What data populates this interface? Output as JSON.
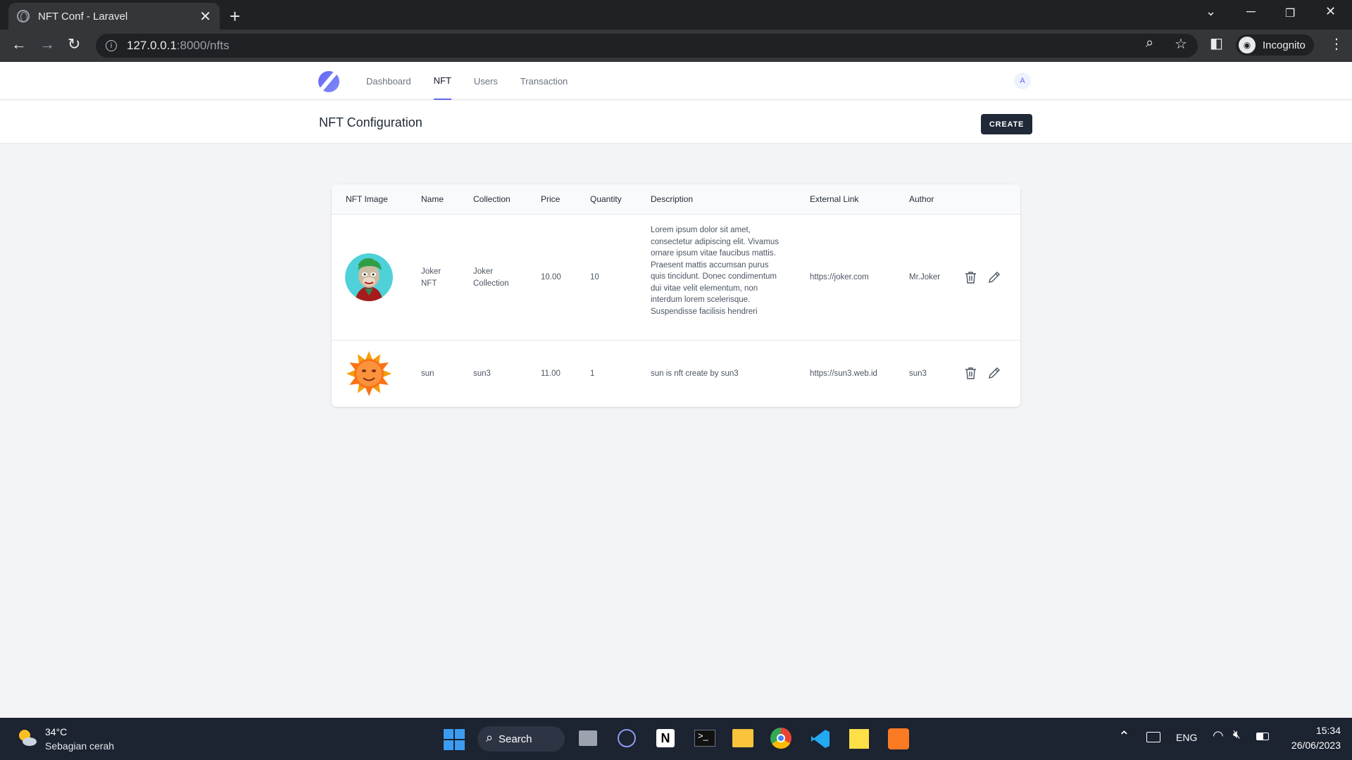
{
  "browser": {
    "tab_title": "NFT Conf - Laravel",
    "url_host": "127.0.0.1",
    "url_path": ":8000/nfts",
    "profile_label": "Incognito"
  },
  "nav": {
    "items": [
      {
        "label": "Dashboard"
      },
      {
        "label": "NFT",
        "active": true
      },
      {
        "label": "Users"
      },
      {
        "label": "Transaction"
      }
    ],
    "avatar_initial": "A"
  },
  "page": {
    "title": "NFT Configuration",
    "create_label": "CREATE"
  },
  "table": {
    "headers": [
      "NFT Image",
      "Name",
      "Collection",
      "Price",
      "Quantity",
      "Description",
      "External Link",
      "Author"
    ],
    "rows": [
      {
        "image": "joker-ape-avatar",
        "name": "Joker NFT",
        "collection": "Joker Collection",
        "price": "10.00",
        "quantity": "10",
        "description": "Lorem ipsum dolor sit amet, consectetur adipiscing elit. Vivamus ornare ipsum vitae faucibus mattis. Praesent mattis accumsan purus quis tincidunt. Donec condimentum dui vitae velit elementum, non interdum lorem scelerisque. Suspendisse facilisis hendreri",
        "external_link": "https://joker.com",
        "author": "Mr.Joker"
      },
      {
        "image": "sun-face",
        "name": "sun",
        "collection": "sun3",
        "price": "11.00",
        "quantity": "1",
        "description": "sun is nft create by sun3",
        "external_link": "https://sun3.web.id",
        "author": "sun3"
      }
    ]
  },
  "taskbar": {
    "weather_temp": "34°C",
    "weather_desc": "Sebagian cerah",
    "search_label": "Search",
    "lang": "ENG",
    "time": "15:34",
    "date": "26/06/2023"
  },
  "colors": {
    "accent": "#6366f1",
    "create_button": "#1f2937",
    "taskbar": "#1c2331"
  }
}
